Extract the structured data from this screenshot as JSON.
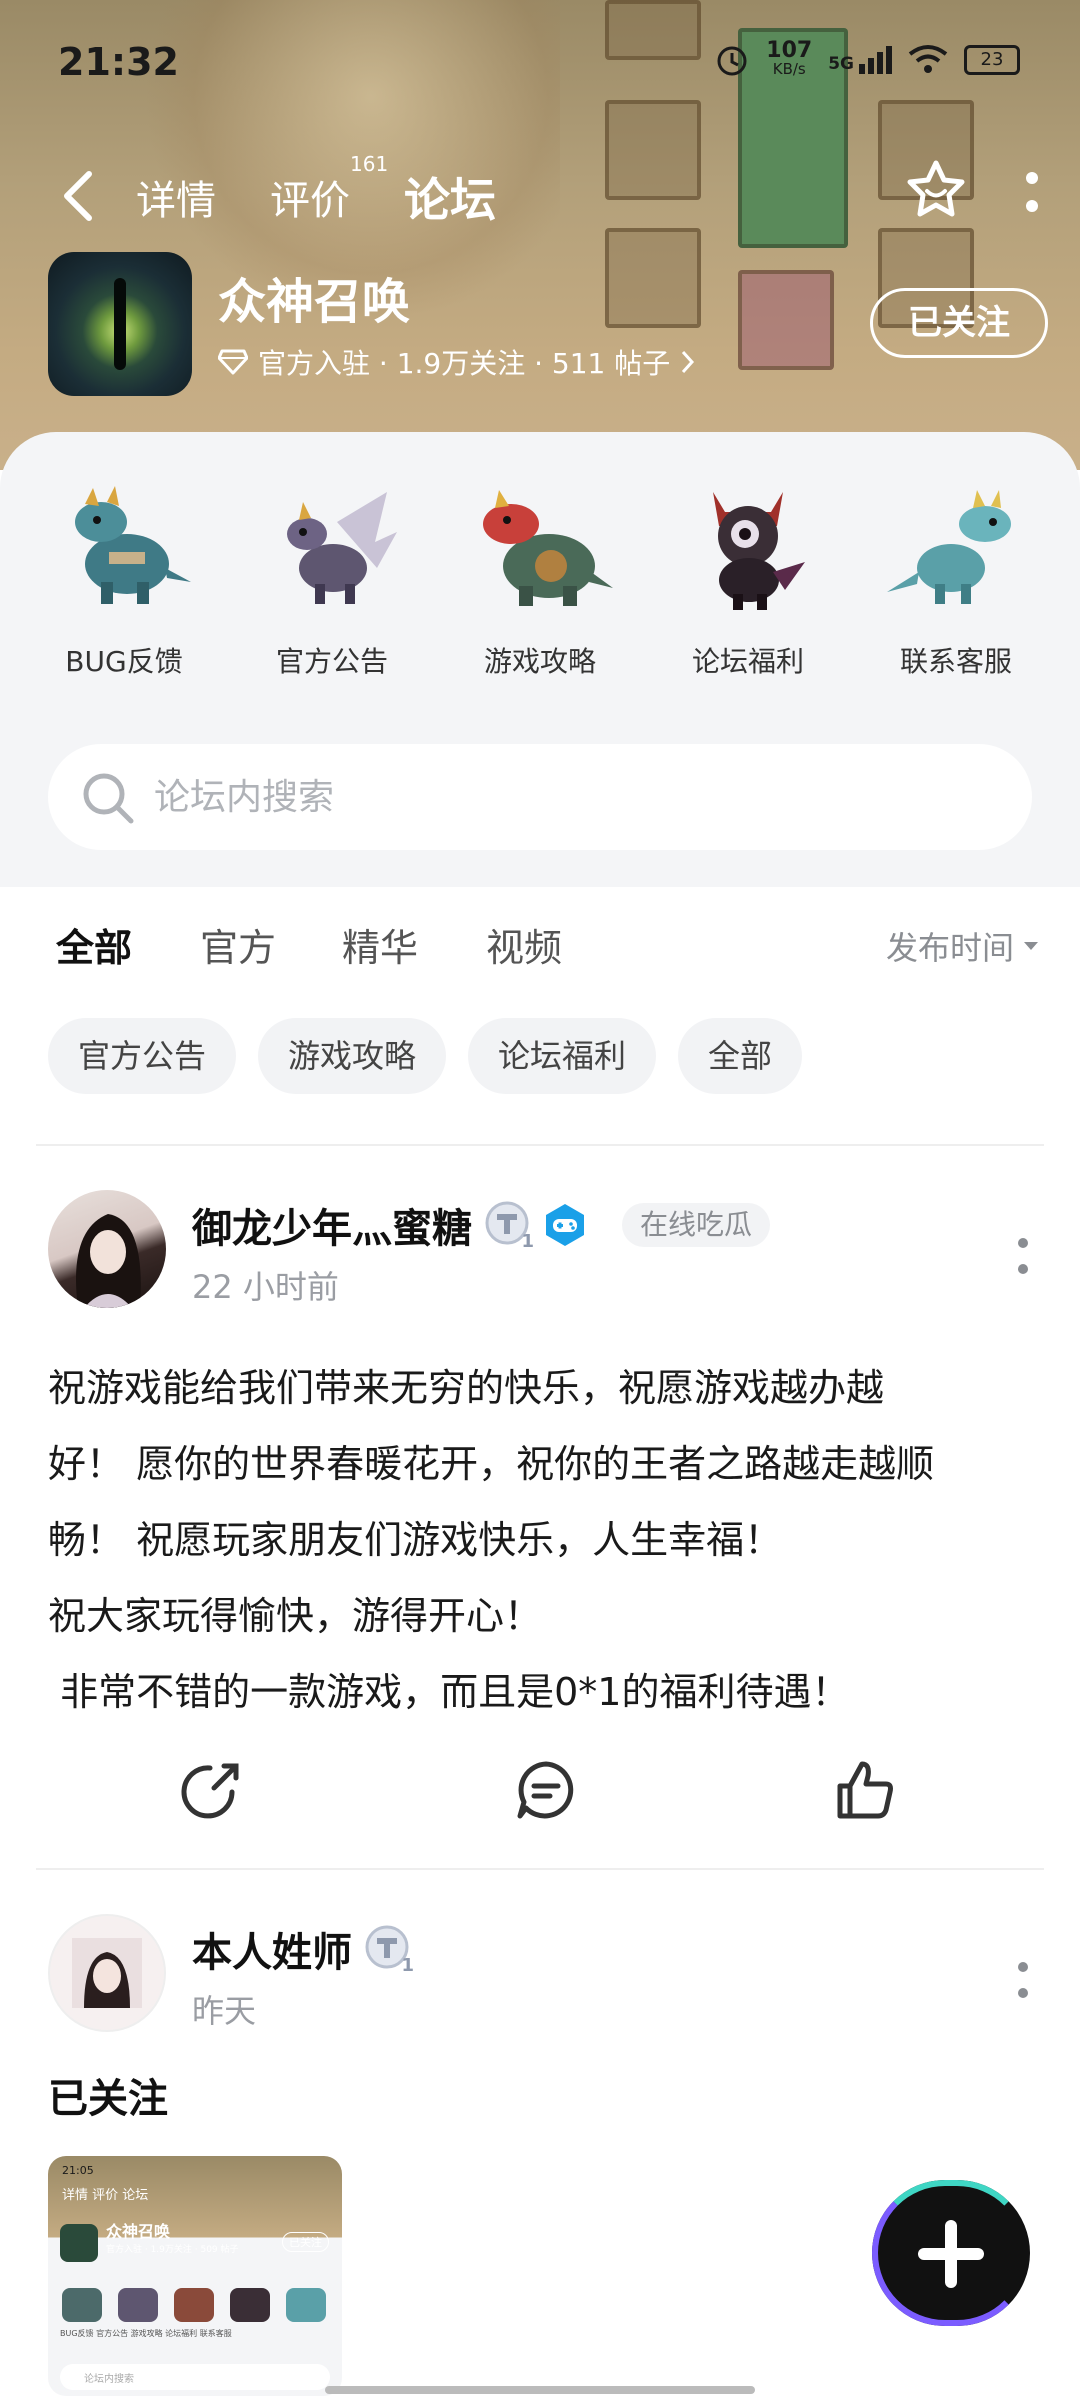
{
  "status_bar": {
    "time": "21:32",
    "net_speed_value": "107",
    "net_speed_unit": "KB/s",
    "network_type": "5G",
    "battery": "23"
  },
  "nav": {
    "tabs": [
      {
        "label": "详情"
      },
      {
        "label": "评价",
        "badge": "161"
      },
      {
        "label": "论坛",
        "active": true
      }
    ]
  },
  "app": {
    "name": "众神召唤",
    "meta": "官方入驻 · 1.9万关注 · 511 帖子",
    "follow_label": "已关注"
  },
  "categories": [
    {
      "label": "BUG反馈",
      "icon": "blue-dragon-icon"
    },
    {
      "label": "官方公告",
      "icon": "winged-dragon-icon"
    },
    {
      "label": "游戏攻略",
      "icon": "red-dragon-icon"
    },
    {
      "label": "论坛福利",
      "icon": "dark-knight-icon"
    },
    {
      "label": "联系客服",
      "icon": "green-dragon-icon"
    }
  ],
  "search": {
    "placeholder": "论坛内搜索"
  },
  "filter_tabs": [
    {
      "label": "全部",
      "active": true
    },
    {
      "label": "官方"
    },
    {
      "label": "精华"
    },
    {
      "label": "视频"
    }
  ],
  "sort": {
    "label": "发布时间"
  },
  "chips": [
    "官方公告",
    "游戏攻略",
    "论坛福利",
    "全部"
  ],
  "posts": [
    {
      "username": "御龙少年灬蜜糖",
      "level": "1",
      "tag": "在线吃瓜",
      "time": "22 小时前",
      "text": "祝游戏能给我们带来无穷的快乐，祝愿游戏越办越\n好！ 愿你的世界春暖花开，祝你的王者之路越走越顺\n畅！ 祝愿玩家朋友们游戏快乐，人生幸福！\n祝大家玩得愉快，游得开心！\n 非常不错的一款游戏，而且是0*1的福利待遇！"
    },
    {
      "username": "本人姓师",
      "level": "1",
      "time": "昨天",
      "heading": "已关注",
      "thumb": {
        "time": "21:05",
        "tabs": "详情   评价   论坛",
        "name": "众神召唤",
        "meta": "官方入驻 · 1.9万关注 · 509 帖子",
        "follow_label": "已关注",
        "cat_labels": "BUG反馈   官方公告   游戏攻略   论坛福利   联系客服",
        "search_placeholder": "论坛内搜索"
      }
    }
  ],
  "colors": {
    "accent": "#3fd6c4",
    "hero": "#b3a07a",
    "panel": "#f4f5f7",
    "game_badge": "#1aa0e8"
  }
}
